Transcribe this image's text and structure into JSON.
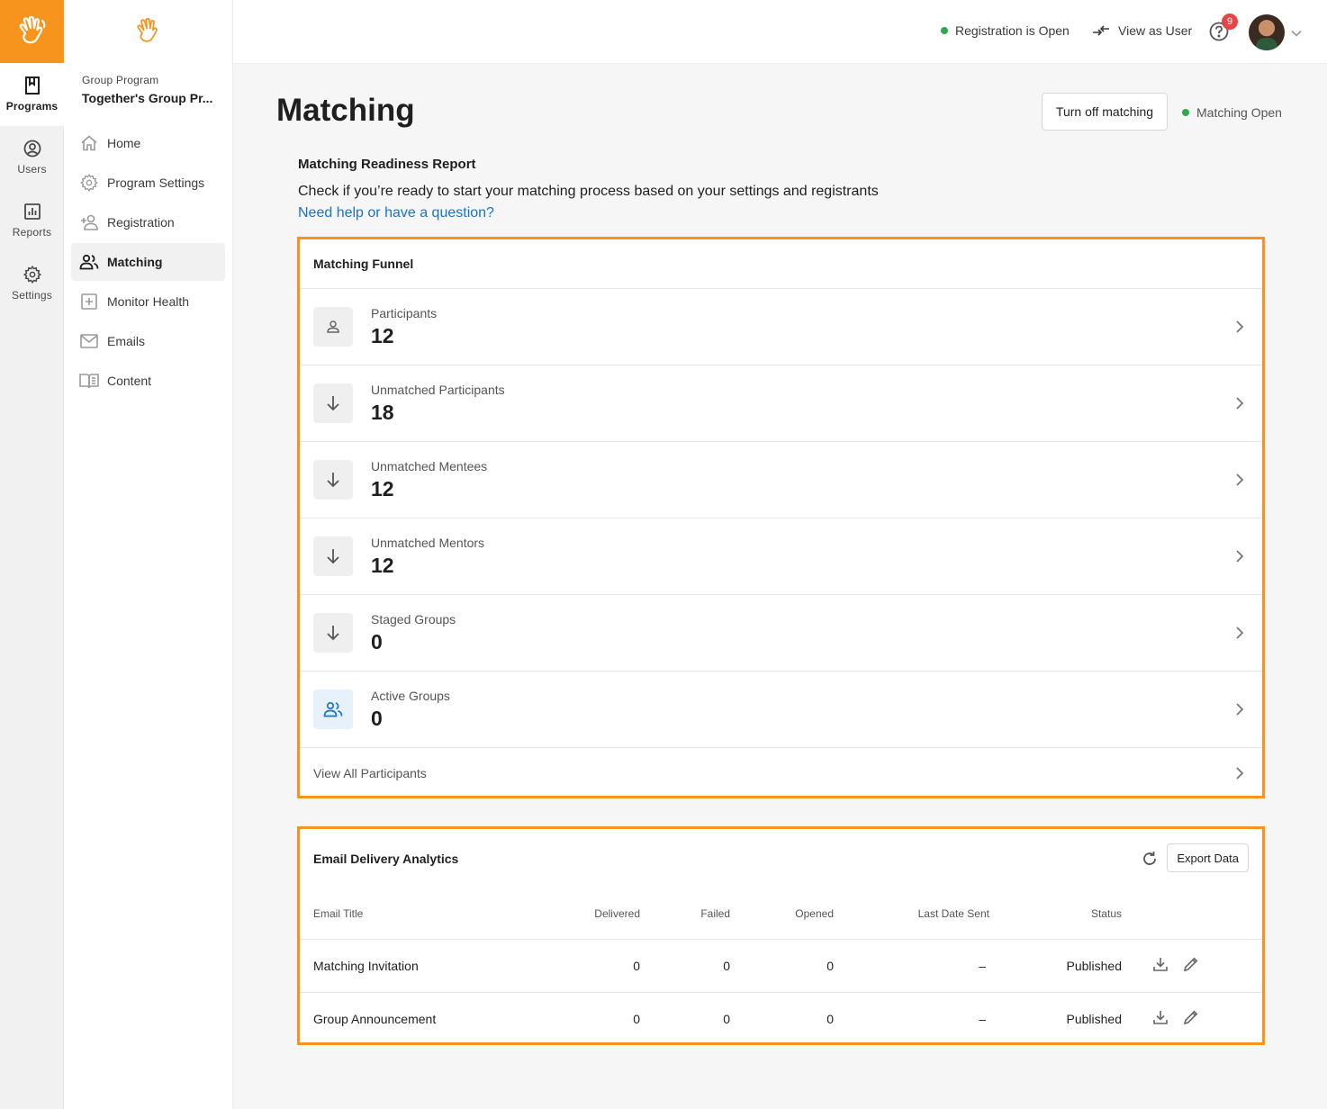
{
  "rail": {
    "items": [
      {
        "label": "Programs",
        "icon": "bookmark-icon",
        "active": true
      },
      {
        "label": "Users",
        "icon": "user-circle-icon",
        "active": false
      },
      {
        "label": "Reports",
        "icon": "bar-chart-icon",
        "active": false
      },
      {
        "label": "Settings",
        "icon": "gear-icon",
        "active": false
      }
    ]
  },
  "subnav": {
    "program_type": "Group Program",
    "program_name": "Together's Group Pr...",
    "items": [
      {
        "label": "Home",
        "icon": "home-icon"
      },
      {
        "label": "Program Settings",
        "icon": "gear-icon"
      },
      {
        "label": "Registration",
        "icon": "add-user-icon"
      },
      {
        "label": "Matching",
        "icon": "people-icon"
      },
      {
        "label": "Monitor Health",
        "icon": "plus-square-icon"
      },
      {
        "label": "Emails",
        "icon": "mail-icon"
      },
      {
        "label": "Content",
        "icon": "book-icon"
      }
    ],
    "active": "Matching"
  },
  "topbar": {
    "registration_status": "Registration is Open",
    "view_as_user": "View as User",
    "notification_count": "9"
  },
  "page": {
    "title": "Matching",
    "turn_off_button": "Turn off matching",
    "matching_status": "Matching Open"
  },
  "report": {
    "title": "Matching Readiness Report",
    "description": "Check if you’re ready to start your matching process based on your settings and registrants",
    "help_link": "Need help or have a question?"
  },
  "funnel": {
    "title": "Matching Funnel",
    "rows": [
      {
        "label": "Participants",
        "value": "12",
        "icon": "person-icon"
      },
      {
        "label": "Unmatched Participants",
        "value": "18",
        "icon": "arrow-down-icon"
      },
      {
        "label": "Unmatched Mentees",
        "value": "12",
        "icon": "arrow-down-icon"
      },
      {
        "label": "Unmatched Mentors",
        "value": "12",
        "icon": "arrow-down-icon"
      },
      {
        "label": "Staged Groups",
        "value": "0",
        "icon": "arrow-down-icon"
      },
      {
        "label": "Active Groups",
        "value": "0",
        "icon": "people-icon"
      }
    ],
    "view_all": "View All Participants"
  },
  "email_analytics": {
    "title": "Email Delivery Analytics",
    "export_button": "Export Data",
    "columns": [
      "Email Title",
      "Delivered",
      "Failed",
      "Opened",
      "Last Date Sent",
      "Status"
    ],
    "rows": [
      {
        "title": "Matching Invitation",
        "delivered": "0",
        "failed": "0",
        "opened": "0",
        "last_sent": "–",
        "status": "Published"
      },
      {
        "title": "Group Announcement",
        "delivered": "0",
        "failed": "0",
        "opened": "0",
        "last_sent": "–",
        "status": "Published"
      }
    ]
  },
  "colors": {
    "brand_orange": "#f7941d",
    "status_green": "#2daa4b",
    "link_blue": "#1a73c8",
    "badge_red": "#e54545"
  }
}
